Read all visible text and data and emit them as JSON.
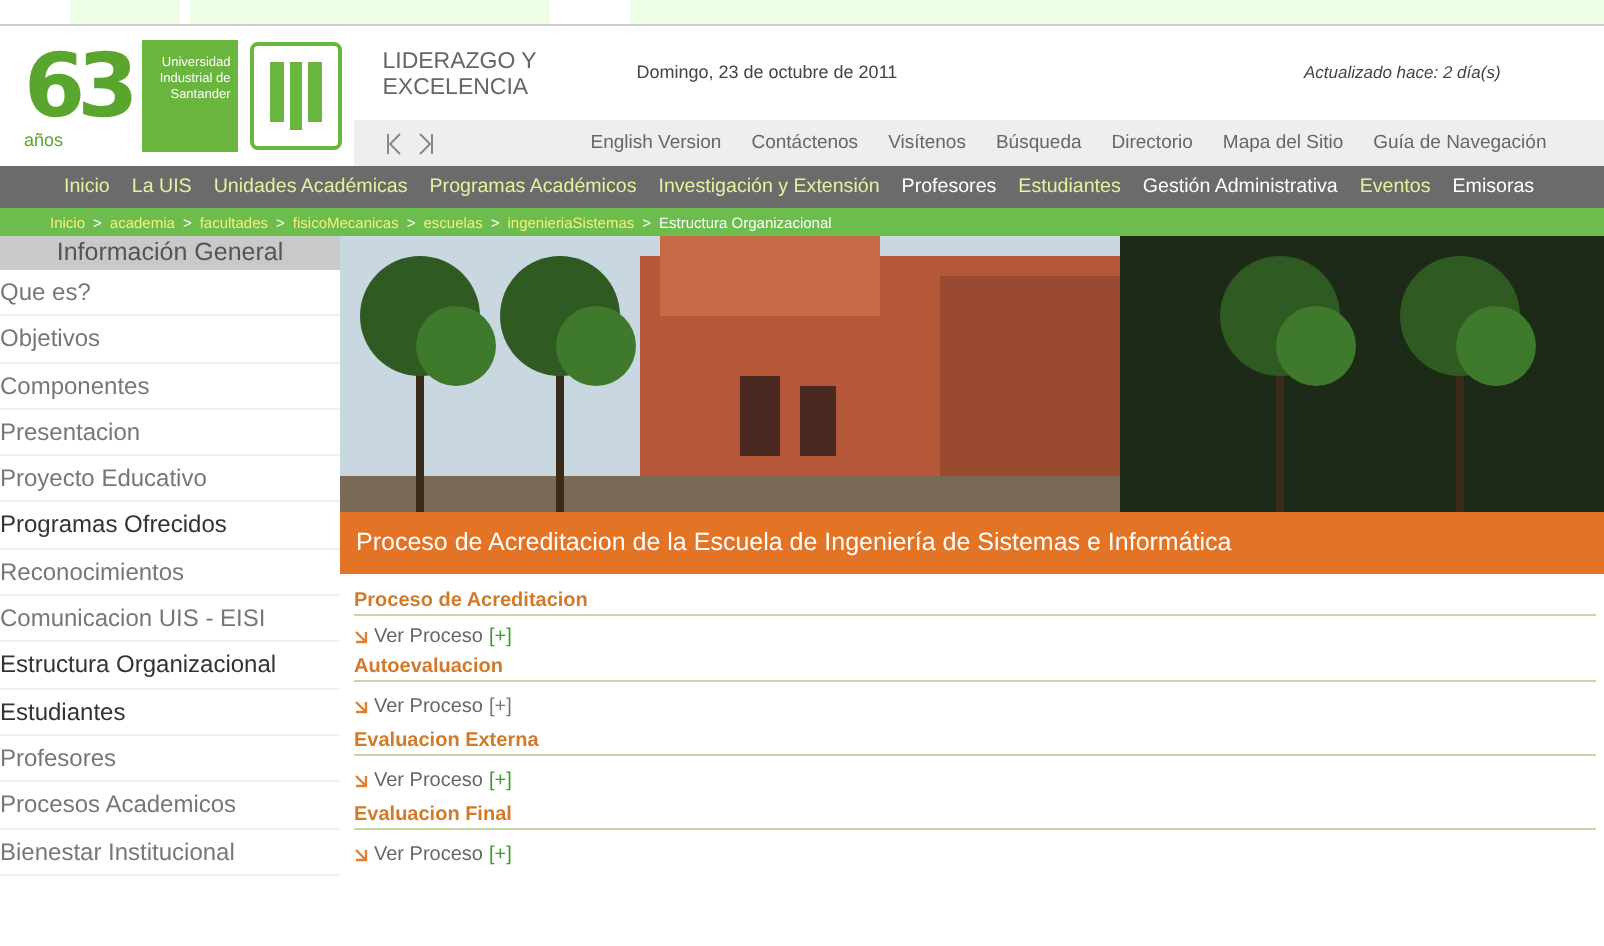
{
  "logo": {
    "number": "63",
    "caption": "años"
  },
  "university": "Universidad Industrial de Santander",
  "slogan": "LIDERAZGO Y EXCELENCIA",
  "date": "Domingo, 23 de octubre de 2011",
  "updated": "Actualizado hace: 2 día(s)",
  "top_links": [
    "English Version",
    "Contáctenos",
    "Visítenos",
    "Búsqueda",
    "Directorio",
    "Mapa del Sitio",
    "Guía de Navegación"
  ],
  "menu": [
    {
      "label": "Inicio",
      "color": "#e8f0a0"
    },
    {
      "label": "La UIS",
      "color": "#e8f0a0"
    },
    {
      "label": "Unidades Académicas",
      "color": "#e8f0a0"
    },
    {
      "label": "Programas Académicos",
      "color": "#e8f0a0"
    },
    {
      "label": "Investigación y Extensión",
      "color": "#e8f0a0"
    },
    {
      "label": "Profesores",
      "color": "#ffffff"
    },
    {
      "label": "Estudiantes",
      "color": "#e8f0a0"
    },
    {
      "label": "Gestión Administrativa",
      "color": "#ffffff"
    },
    {
      "label": "Eventos",
      "color": "#e8f0a0"
    },
    {
      "label": "Emisoras",
      "color": "#ffffff"
    }
  ],
  "breadcrumb_separator": ">",
  "breadcrumb": [
    {
      "label": "Inicio",
      "selected": false
    },
    {
      "label": "academia",
      "selected": false
    },
    {
      "label": "facultades",
      "selected": false
    },
    {
      "label": "fisicoMecanicas",
      "selected": false
    },
    {
      "label": "escuelas",
      "selected": false
    },
    {
      "label": "ingenieriaSistemas",
      "selected": false
    },
    {
      "label": "Estructura Organizacional",
      "selected": true
    }
  ],
  "sidebar": {
    "title": "Información General",
    "items": [
      {
        "label": "Que es?",
        "emphasis": false
      },
      {
        "label": "Objetivos",
        "emphasis": false
      },
      {
        "label": "Componentes",
        "emphasis": false
      },
      {
        "label": "Presentacion",
        "emphasis": false
      },
      {
        "label": "Proyecto Educativo",
        "emphasis": false
      },
      {
        "label": "Programas Ofrecidos",
        "emphasis": true
      },
      {
        "label": "Reconocimientos",
        "emphasis": false
      },
      {
        "label": "Comunicacion UIS - EISI",
        "emphasis": false
      },
      {
        "label": "Estructura Organizacional",
        "emphasis": true
      },
      {
        "label": "Estudiantes",
        "emphasis": true
      },
      {
        "label": "Profesores",
        "emphasis": false
      },
      {
        "label": "Procesos Academicos",
        "emphasis": false
      },
      {
        "label": "Bienestar Institucional",
        "emphasis": false
      }
    ]
  },
  "banner": {
    "kind": "picture",
    "title": "Proceso de Acreditacion de la Escuela de Ingeniería de Sistemas e Informática"
  },
  "sections": [
    {
      "heading": "Proceso de Acreditacion",
      "link": "Ver Proceso",
      "expander": "[+]",
      "expander_active": true
    },
    {
      "heading": "Autoevaluacion",
      "link": "Ver Proceso",
      "expander": "[+]",
      "expander_active": false
    },
    {
      "heading": "Evaluacion Externa",
      "link": "Ver Proceso",
      "expander": "[+]",
      "expander_active": true
    },
    {
      "heading": "Evaluacion Final",
      "link": "Ver Proceso",
      "expander": "[+]",
      "expander_active": true
    }
  ]
}
